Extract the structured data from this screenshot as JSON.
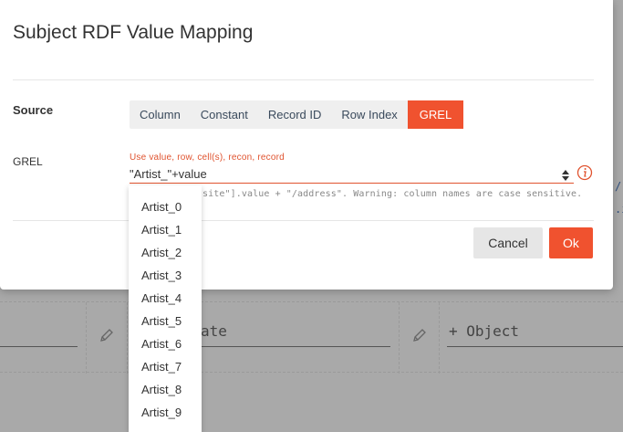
{
  "dialog": {
    "title": "Subject RDF Value Mapping",
    "source_label": "Source",
    "source_options": [
      "Column",
      "Constant",
      "Record ID",
      "Row Index",
      "GREL"
    ],
    "selected_source": "GREL",
    "grel_label": "GREL",
    "grel_hint": "Use value, row, cell(s), recon, record",
    "grel_value": "\"Artist_\"+value",
    "grel_example": "site\"].value + \"/address\". Warning: column names are case sensitive.",
    "cancel_label": "Cancel",
    "ok_label": "Ok"
  },
  "autocomplete": {
    "items": [
      "Artist_0",
      "Artist_1",
      "Artist_2",
      "Artist_3",
      "Artist_4",
      "Artist_5",
      "Artist_6",
      "Artist_7",
      "Artist_8",
      "Artist_9"
    ]
  },
  "background": {
    "predicate_partial": "ate",
    "object_placeholder": "+ Object",
    "link_fragment_1": "/",
    "link_fragment_2": ".i"
  },
  "colors": {
    "accent": "#f0522f",
    "overlay": "#a9a9a9"
  }
}
